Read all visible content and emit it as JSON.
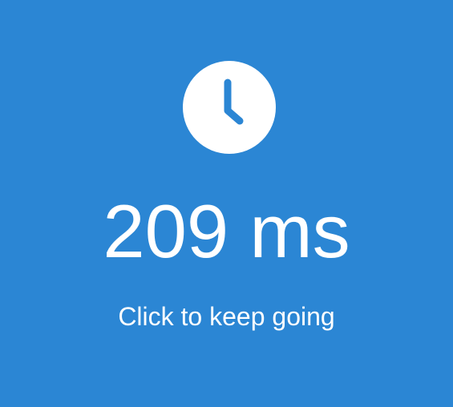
{
  "theme": {
    "background": "#2b86d4",
    "foreground": "#ffffff"
  },
  "icon": "clock-icon",
  "result": {
    "value": "209",
    "unit": "ms"
  },
  "prompt": "Click to keep going"
}
